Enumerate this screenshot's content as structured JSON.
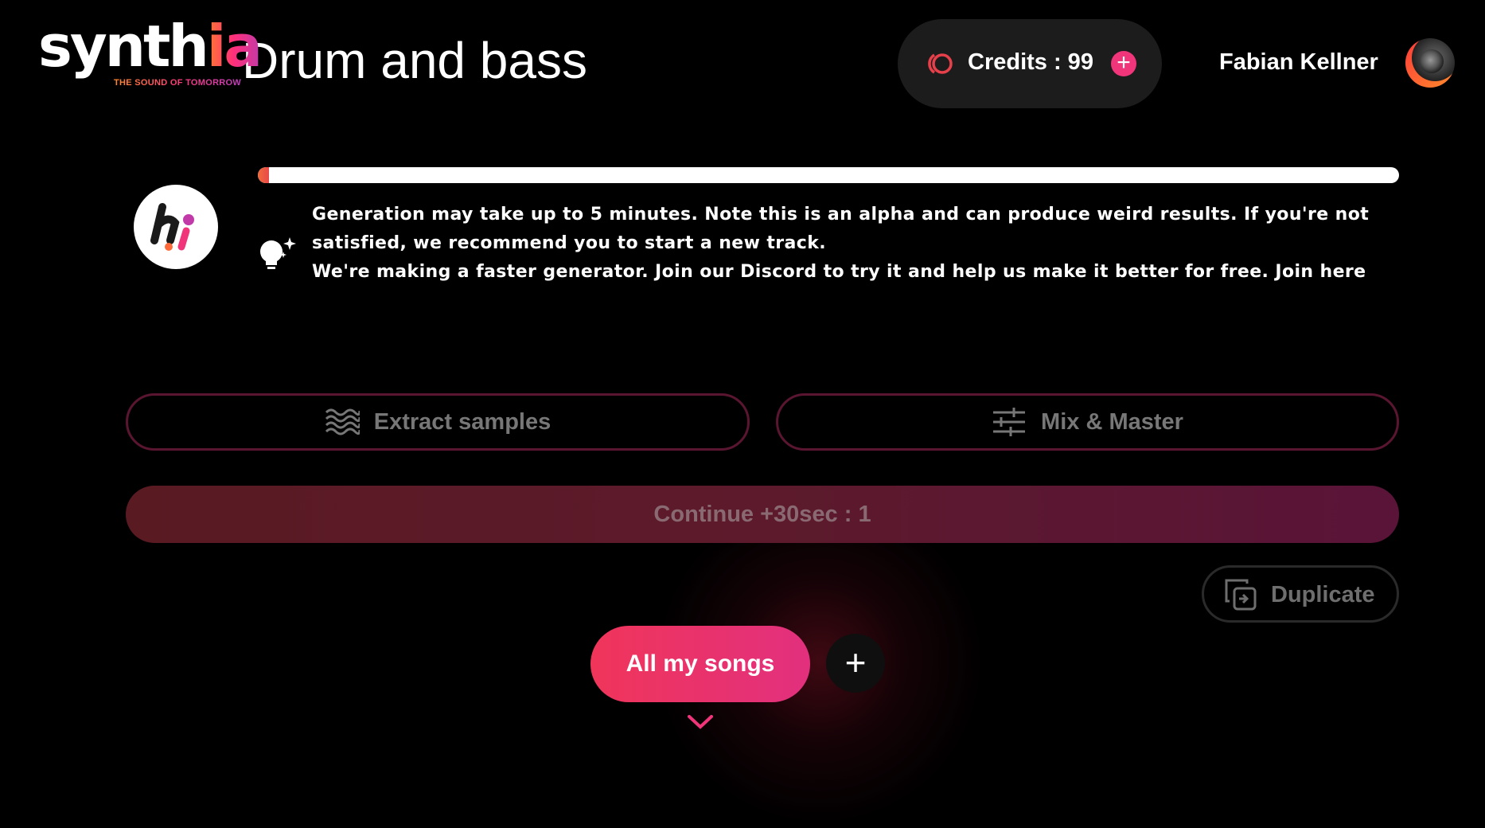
{
  "header": {
    "logo_text": "synthia",
    "logo_tagline": "THE SOUND OF TOMORROW",
    "track_title": "Drum and bass",
    "credits_label": "Credits : 99",
    "add_credits_icon": "plus-icon",
    "user_name": "Fabian Kellner"
  },
  "progress": {
    "value": 0.01
  },
  "notice": {
    "line1": "Generation may take up to 5 minutes. Note this is an alpha and can produce weird results. If you're not satisfied, we recommend you to start a new track.",
    "line2": "We're making a faster generator. Join our Discord to try it and help us make it better for free. Join here"
  },
  "actions": {
    "extract_label": "Extract samples",
    "mix_label": "Mix & Master",
    "continue_label": "Continue +30sec : 1",
    "duplicate_label": "Duplicate"
  },
  "footer": {
    "all_songs_label": "All my songs",
    "add_label": "+"
  },
  "colors": {
    "accent": "#f0357a",
    "background": "#000000",
    "outline": "#5a1530"
  }
}
